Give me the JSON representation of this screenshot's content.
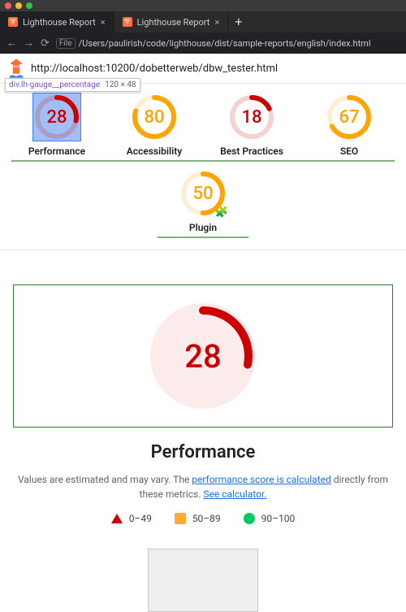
{
  "browser": {
    "tabs": [
      {
        "title": "Lighthouse Report",
        "active": true
      },
      {
        "title": "Lighthouse Report",
        "active": false
      }
    ],
    "nav": {
      "back": "←",
      "fwd": "→",
      "reload": "⟳"
    },
    "addr_label": "File",
    "addr_path": "/Users/paulirish/code/lighthouse/dist/sample-reports/english/index.html"
  },
  "topbar": {
    "url": "http://localhost:10200/dobetterweb/dbw_tester.html"
  },
  "dev_tooltip": {
    "selector": "div.lh-gauge__percentage",
    "dims": "120 × 48"
  },
  "gauges": [
    {
      "id": "performance",
      "label": "Performance",
      "score": 28,
      "class": "fail",
      "highlighted": true
    },
    {
      "id": "accessibility",
      "label": "Accessibility",
      "score": 80,
      "class": "average"
    },
    {
      "id": "best-practices",
      "label": "Best Practices",
      "score": 18,
      "class": "fail"
    },
    {
      "id": "seo",
      "label": "SEO",
      "score": 67,
      "class": "average"
    },
    {
      "id": "plugin",
      "label": "Plugin",
      "score": 50,
      "class": "average",
      "plugin": true
    }
  ],
  "detail": {
    "score": 28,
    "title": "Performance",
    "desc_prefix": "Values are estimated and may vary. The ",
    "desc_link1": "performance score is calculated",
    "desc_mid": " directly from these metrics. ",
    "desc_link2": "See calculator."
  },
  "legend": {
    "fail": "0–49",
    "avg": "50–89",
    "pass": "90–100"
  },
  "colors": {
    "fail": "#cc0000",
    "avg": "#ffa400",
    "pass": "#00cc66"
  }
}
